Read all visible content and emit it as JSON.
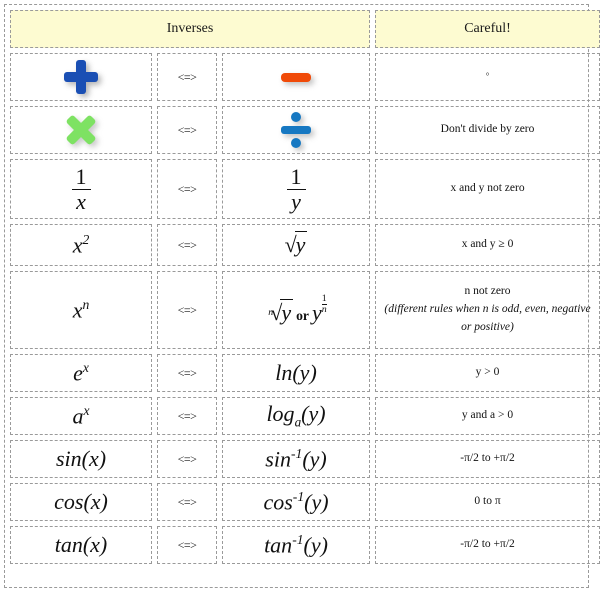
{
  "header": {
    "inverses_label": "Inverses",
    "careful_label": "Careful!"
  },
  "arrow_symbol": "<=>",
  "colors": {
    "header_bg": "#fdfbd1",
    "border": "#9a9a9a",
    "plus": "#1a4fb4",
    "minus": "#f04a08",
    "times": "#7ee263",
    "divide": "#1678c2"
  },
  "rows": [
    {
      "function_kind": "icon-plus",
      "function_text": "+",
      "inverse_kind": "icon-minus",
      "inverse_text": "−",
      "careful_kind": "degree",
      "careful_text": "°"
    },
    {
      "function_kind": "icon-times",
      "function_text": "×",
      "inverse_kind": "icon-divide",
      "inverse_text": "÷",
      "careful_kind": "text",
      "careful_text": "Don't divide by zero"
    },
    {
      "function_kind": "fraction",
      "function_num": "1",
      "function_den": "x",
      "function_text": "1/x",
      "inverse_kind": "fraction",
      "inverse_num": "1",
      "inverse_den": "y",
      "inverse_text": "1/y",
      "careful_kind": "text",
      "careful_text": "x and y not zero"
    },
    {
      "function_kind": "power",
      "function_base": "x",
      "function_exp": "2",
      "function_text": "x²",
      "inverse_kind": "sqrt",
      "inverse_radicand": "y",
      "inverse_text": "√y",
      "careful_kind": "text",
      "careful_text": "x and y ≥ 0"
    },
    {
      "function_kind": "power",
      "function_base": "x",
      "function_exp": "n",
      "function_text": "xⁿ",
      "inverse_kind": "nthroot",
      "inverse_index": "n",
      "inverse_radicand": "y",
      "inverse_or": "or",
      "inverse_alt_base": "y",
      "inverse_alt_num": "1",
      "inverse_alt_den": "n",
      "inverse_text": "ⁿ√y or y^(1/n)",
      "careful_kind": "two-line",
      "careful_text": "n not zero",
      "careful_text_italic": "(different rules when n is odd, even, negative or positive)"
    },
    {
      "function_kind": "power",
      "function_base": "e",
      "function_exp": "x",
      "function_text": "eˣ",
      "inverse_kind": "func",
      "inverse_name": "ln",
      "inverse_arg": "(y)",
      "inverse_text": "ln(y)",
      "careful_kind": "text",
      "careful_text": "y > 0"
    },
    {
      "function_kind": "power",
      "function_base": "a",
      "function_exp": "x",
      "function_text": "aˣ",
      "inverse_kind": "logbase",
      "inverse_name": "log",
      "inverse_base": "a",
      "inverse_arg": "(y)",
      "inverse_text": "logₐ(y)",
      "careful_kind": "text",
      "careful_text": "y and a > 0"
    },
    {
      "function_kind": "func",
      "function_name": "sin",
      "function_arg": "(x)",
      "function_text": "sin(x)",
      "inverse_kind": "invfunc",
      "inverse_name": "sin",
      "inverse_exp": "-1",
      "inverse_arg": "(y)",
      "inverse_text": "sin⁻¹(y)",
      "careful_kind": "text",
      "careful_text": "-π/2 to +π/2"
    },
    {
      "function_kind": "func",
      "function_name": "cos",
      "function_arg": "(x)",
      "function_text": "cos(x)",
      "inverse_kind": "invfunc",
      "inverse_name": "cos",
      "inverse_exp": "-1",
      "inverse_arg": "(y)",
      "inverse_text": "cos⁻¹(y)",
      "careful_kind": "text",
      "careful_text": "0 to π"
    },
    {
      "function_kind": "func",
      "function_name": "tan",
      "function_arg": "(x)",
      "function_text": "tan(x)",
      "inverse_kind": "invfunc",
      "inverse_name": "tan",
      "inverse_exp": "-1",
      "inverse_arg": "(y)",
      "inverse_text": "tan⁻¹(y)",
      "careful_kind": "text",
      "careful_text": "-π/2 to +π/2"
    }
  ]
}
